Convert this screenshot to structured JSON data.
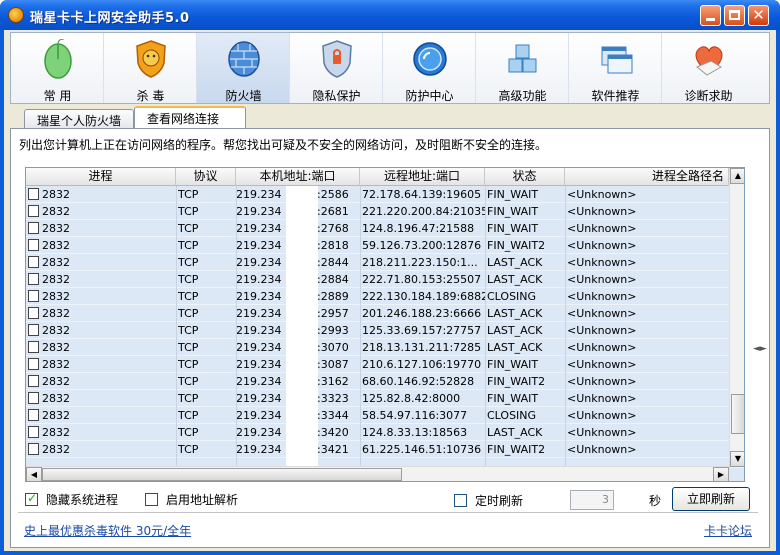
{
  "window": {
    "title": "瑞星卡卡上网安全助手5.0"
  },
  "toolbar": {
    "items": [
      {
        "label": "常 用",
        "icon": "mouse-icon"
      },
      {
        "label": "杀 毒",
        "icon": "lion-shield-icon"
      },
      {
        "label": "防火墙",
        "icon": "firewall-icon"
      },
      {
        "label": "隐私保护",
        "icon": "privacy-shield-icon"
      },
      {
        "label": "防护中心",
        "icon": "protection-center-icon"
      },
      {
        "label": "高级功能",
        "icon": "cubes-icon"
      },
      {
        "label": "软件推荐",
        "icon": "windows-icon"
      },
      {
        "label": "诊断求助",
        "icon": "heart-hand-icon"
      }
    ],
    "active_index": 2
  },
  "tabs": [
    {
      "label": "瑞星个人防火墙"
    },
    {
      "label": "查看网络连接"
    }
  ],
  "description": "列出您计算机上正在访问网络的程序。帮您找出可疑及不安全的网络访问，及时阻断不安全的连接。",
  "table": {
    "columns": [
      "进程",
      "协议",
      "本机地址:端口",
      "远程地址:端口",
      "状态",
      "进程全路径名"
    ],
    "rows": [
      {
        "pid": "2832",
        "proto": "TCP",
        "local_ip": "219.234.",
        "local_port": ":2586",
        "remote": "72.178.64.139:19605",
        "state": "FIN_WAIT",
        "path": "<Unknown>"
      },
      {
        "pid": "2832",
        "proto": "TCP",
        "local_ip": "219.234.",
        "local_port": ":2681",
        "remote": "221.220.200.84:21035",
        "state": "FIN_WAIT",
        "path": "<Unknown>"
      },
      {
        "pid": "2832",
        "proto": "TCP",
        "local_ip": "219.234.",
        "local_port": ":2768",
        "remote": "124.8.196.47:21588",
        "state": "FIN_WAIT",
        "path": "<Unknown>"
      },
      {
        "pid": "2832",
        "proto": "TCP",
        "local_ip": "219.234.",
        "local_port": ":2818",
        "remote": "59.126.73.200:12876",
        "state": "FIN_WAIT2",
        "path": "<Unknown>"
      },
      {
        "pid": "2832",
        "proto": "TCP",
        "local_ip": "219.234.",
        "local_port": ":2844",
        "remote": "218.211.223.150:1...",
        "state": "LAST_ACK",
        "path": "<Unknown>"
      },
      {
        "pid": "2832",
        "proto": "TCP",
        "local_ip": "219.234.",
        "local_port": ":2884",
        "remote": "222.71.80.153:25507",
        "state": "LAST_ACK",
        "path": "<Unknown>"
      },
      {
        "pid": "2832",
        "proto": "TCP",
        "local_ip": "219.234.",
        "local_port": ":2889",
        "remote": "222.130.184.189:6882",
        "state": "CLOSING",
        "path": "<Unknown>"
      },
      {
        "pid": "2832",
        "proto": "TCP",
        "local_ip": "219.234.",
        "local_port": ":2957",
        "remote": "201.246.188.23:6666",
        "state": "LAST_ACK",
        "path": "<Unknown>"
      },
      {
        "pid": "2832",
        "proto": "TCP",
        "local_ip": "219.234.",
        "local_port": ":2993",
        "remote": "125.33.69.157:27757",
        "state": "LAST_ACK",
        "path": "<Unknown>"
      },
      {
        "pid": "2832",
        "proto": "TCP",
        "local_ip": "219.234.",
        "local_port": ":3070",
        "remote": "218.13.131.211:7285",
        "state": "LAST_ACK",
        "path": "<Unknown>"
      },
      {
        "pid": "2832",
        "proto": "TCP",
        "local_ip": "219.234.",
        "local_port": ":3087",
        "remote": "210.6.127.106:19770",
        "state": "FIN_WAIT",
        "path": "<Unknown>"
      },
      {
        "pid": "2832",
        "proto": "TCP",
        "local_ip": "219.234.",
        "local_port": ":3162",
        "remote": "68.60.146.92:52828",
        "state": "FIN_WAIT2",
        "path": "<Unknown>"
      },
      {
        "pid": "2832",
        "proto": "TCP",
        "local_ip": "219.234.",
        "local_port": ":3323",
        "remote": "125.82.8.42:8000",
        "state": "FIN_WAIT",
        "path": "<Unknown>"
      },
      {
        "pid": "2832",
        "proto": "TCP",
        "local_ip": "219.234.",
        "local_port": ":3344",
        "remote": "58.54.97.116:3077",
        "state": "CLOSING",
        "path": "<Unknown>"
      },
      {
        "pid": "2832",
        "proto": "TCP",
        "local_ip": "219.234.",
        "local_port": ":3420",
        "remote": "124.8.33.13:18563",
        "state": "LAST_ACK",
        "path": "<Unknown>"
      },
      {
        "pid": "2832",
        "proto": "TCP",
        "local_ip": "219.234.",
        "local_port": ":3421",
        "remote": "61.225.146.51:10736",
        "state": "FIN_WAIT2",
        "path": "<Unknown>"
      }
    ]
  },
  "options": {
    "hide_system_label": "隐藏系统进程",
    "hide_system_checked": true,
    "resolve_address_label": "启用地址解析",
    "resolve_address_checked": false,
    "timed_refresh_label": "定时刷新",
    "timed_refresh_checked": false,
    "interval_value": "3",
    "interval_unit": "秒",
    "refresh_button": "立即刷新"
  },
  "footer": {
    "promo_link": "史上最优惠杀毒软件 30元/全年",
    "forum_link": "卡卡论坛"
  },
  "colors": {
    "title_bar": "#0a57d8",
    "list_background": "#dce8f6",
    "link": "#1a4aa8"
  }
}
